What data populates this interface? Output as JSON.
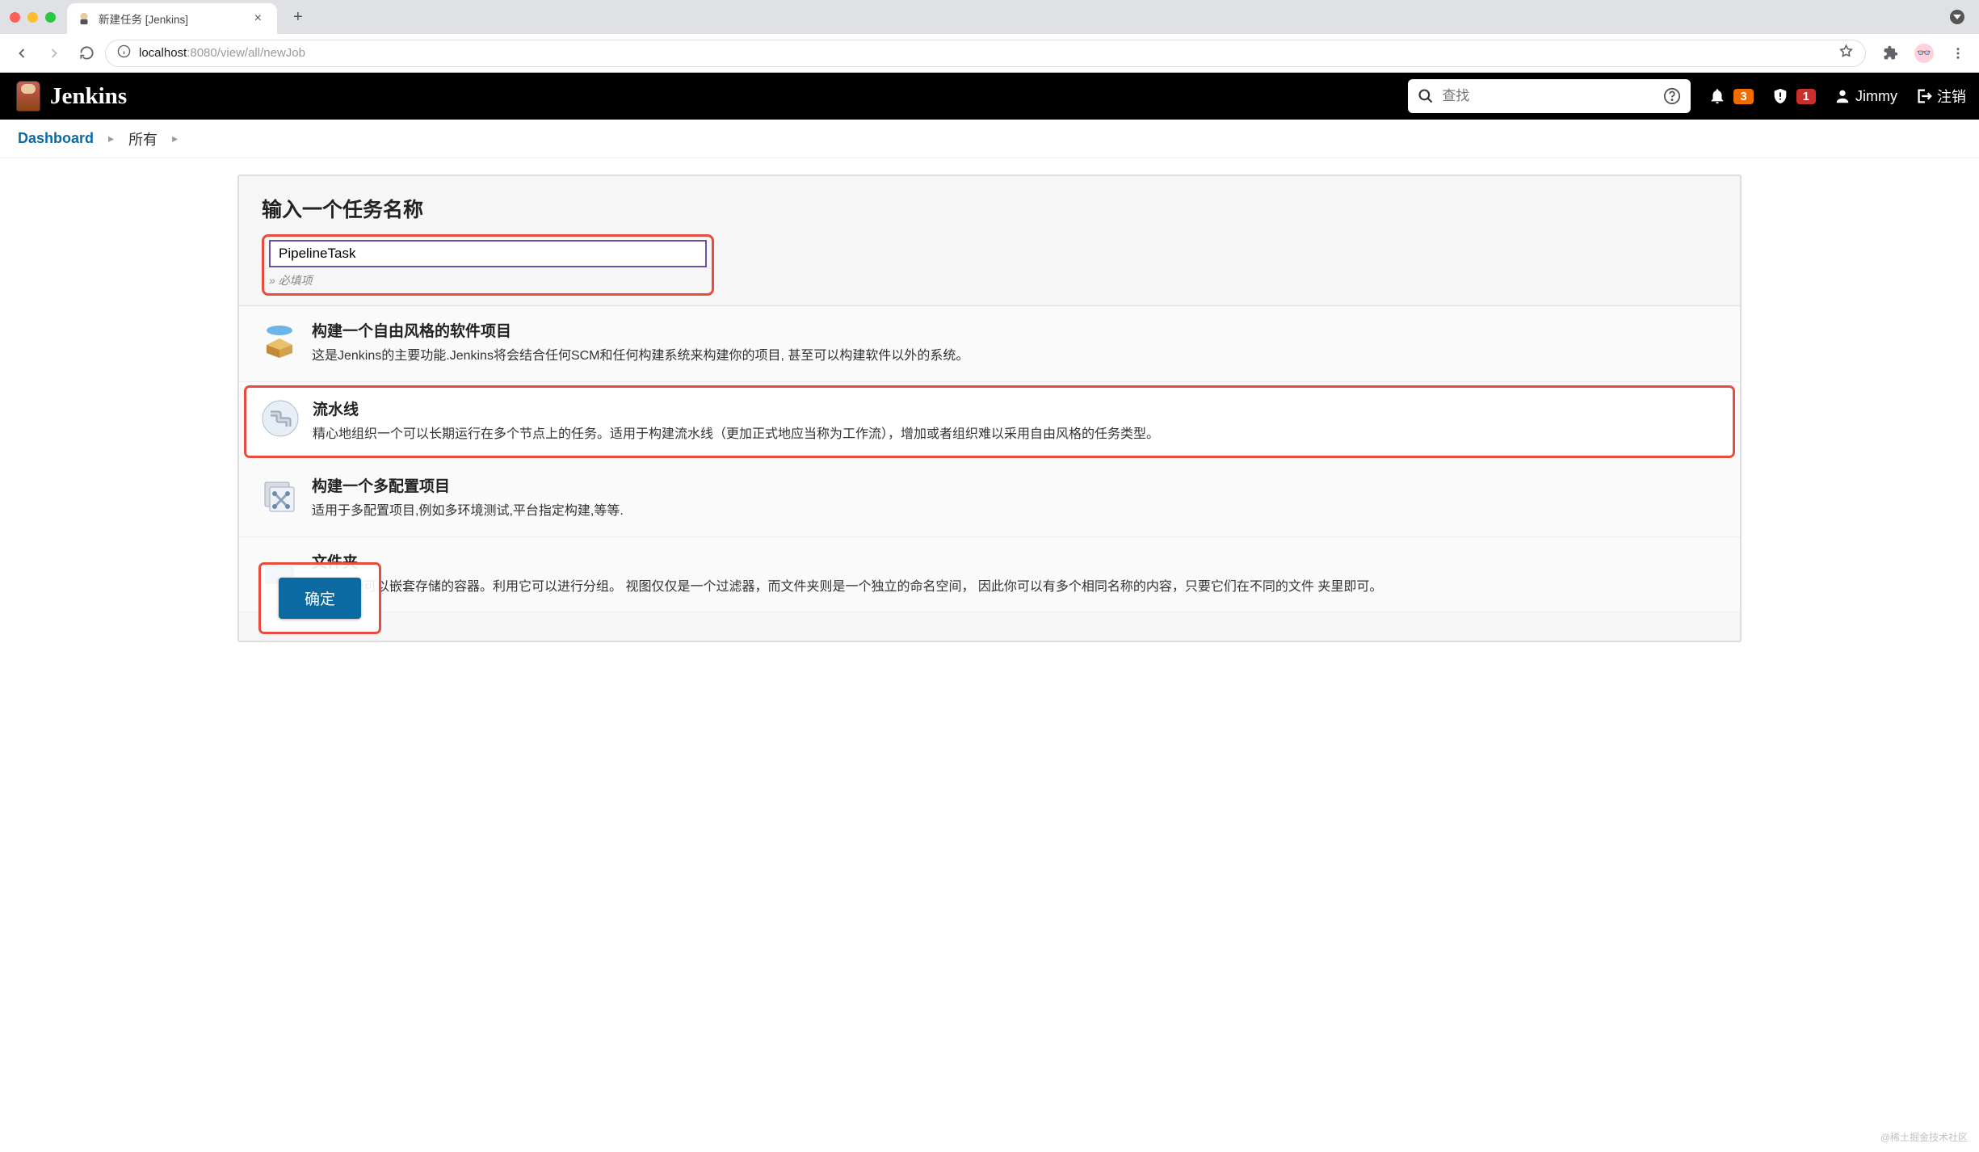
{
  "browser": {
    "tab_title": "新建任务 [Jenkins]",
    "url_host": "localhost",
    "url_port": ":8080",
    "url_path": "/view/all/newJob"
  },
  "header": {
    "app_name": "Jenkins",
    "search_placeholder": "查找",
    "bell_badge": "3",
    "alert_badge": "1",
    "user_name": "Jimmy",
    "logout_label": "注销"
  },
  "breadcrumb": {
    "items": [
      {
        "label": "Dashboard",
        "link": true
      },
      {
        "label": "所有",
        "link": false
      }
    ]
  },
  "form": {
    "name_heading": "输入一个任务名称",
    "name_value": "PipelineTask",
    "required_hint": "» 必填项",
    "submit_label": "确定"
  },
  "item_types": [
    {
      "title": "构建一个自由风格的软件项目",
      "desc": "这是Jenkins的主要功能.Jenkins将会结合任何SCM和任何构建系统来构建你的项目, 甚至可以构建软件以外的系统。",
      "icon": "box",
      "highlighted": false
    },
    {
      "title": "流水线",
      "desc": "精心地组织一个可以长期运行在多个节点上的任务。适用于构建流水线（更加正式地应当称为工作流），增加或者组织难以采用自由风格的任务类型。",
      "icon": "pipeline",
      "highlighted": true
    },
    {
      "title": "构建一个多配置项目",
      "desc": "适用于多配置项目,例如多环境测试,平台指定构建,等等.",
      "icon": "multi",
      "highlighted": false
    },
    {
      "title": "文件夹",
      "desc": "创建一个可以嵌套存储的容器。利用它可以进行分组。 视图仅仅是一个过滤器，而文件夹则是一个独立的命名空间， 因此你可以有多个相同名称的内容，只要它们在不同的文件 夹里即可。",
      "icon": "folder",
      "highlighted": false
    }
  ],
  "watermark": "@稀土掘金技术社区"
}
